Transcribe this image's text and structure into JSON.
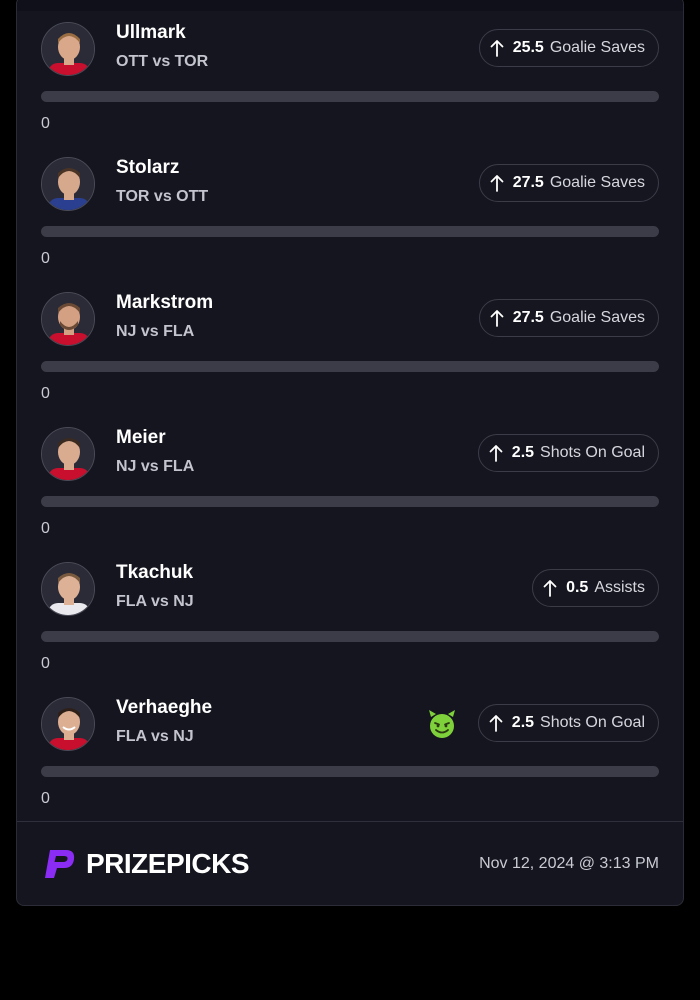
{
  "rows": [
    {
      "name": "Ullmark",
      "matchup": "OTT vs TOR",
      "line": "25.5",
      "stat": "Goalie Saves",
      "progress": "0",
      "progress_fraction": 0,
      "avatar_colors": {
        "jersey": "#c8102e",
        "skin": "#d9a88a",
        "hair": "#9a6d43"
      }
    },
    {
      "name": "Stolarz",
      "matchup": "TOR vs OTT",
      "line": "27.5",
      "stat": "Goalie Saves",
      "progress": "0",
      "progress_fraction": 0,
      "avatar_colors": {
        "jersey": "#2a3f8f",
        "skin": "#d7a98c",
        "hair": "#4a3426"
      }
    },
    {
      "name": "Markstrom",
      "matchup": "NJ vs FLA",
      "line": "27.5",
      "stat": "Goalie Saves",
      "progress": "0",
      "progress_fraction": 0,
      "avatar_colors": {
        "jersey": "#c8102e",
        "skin": "#d4a083",
        "hair": "#6a4a34"
      }
    },
    {
      "name": "Meier",
      "matchup": "NJ vs FLA",
      "line": "2.5",
      "stat": "Shots On Goal",
      "progress": "0",
      "progress_fraction": 0,
      "avatar_colors": {
        "jersey": "#c8102e",
        "skin": "#d9ab8f",
        "hair": "#3b2a20"
      }
    },
    {
      "name": "Tkachuk",
      "matchup": "FLA vs NJ",
      "line": "0.5",
      "stat": "Assists",
      "progress": "0",
      "progress_fraction": 0,
      "avatar_colors": {
        "jersey": "#e9e9ee",
        "skin": "#ddb196",
        "hair": "#7a5a3e"
      }
    },
    {
      "name": "Verhaeghe",
      "matchup": "FLA vs NJ",
      "line": "2.5",
      "stat": "Shots On Goal",
      "progress": "0",
      "progress_fraction": 0,
      "avatar_colors": {
        "jersey": "#c8102e",
        "skin": "#dcae92",
        "hair": "#2e2019"
      },
      "emoji": "devil-smile-icon"
    }
  ],
  "footer": {
    "brand": "PRIZEPICKS",
    "timestamp": "Nov 12, 2024 @ 3:13 PM",
    "brand_color": "#8b2cf5"
  }
}
